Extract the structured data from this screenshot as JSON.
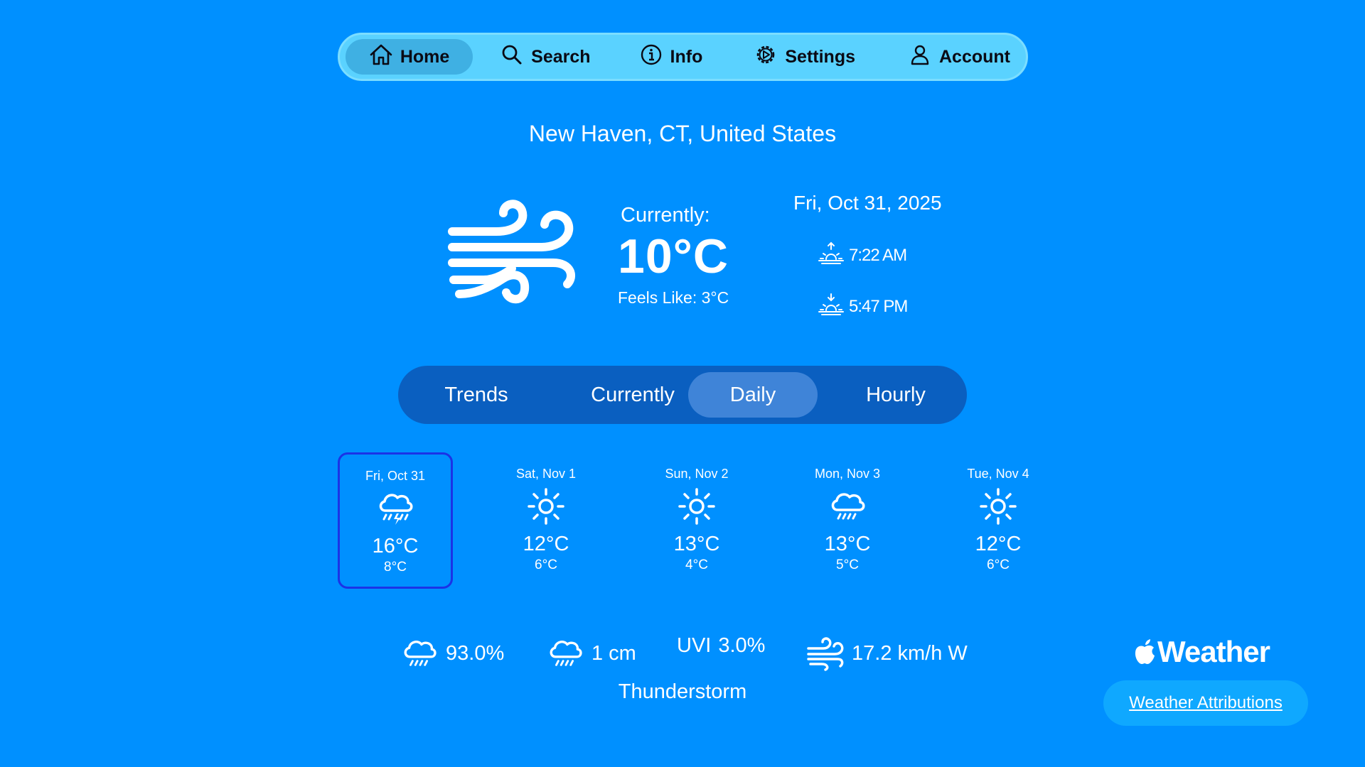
{
  "nav": {
    "home": "Home",
    "search": "Search",
    "info": "Info",
    "settings": "Settings",
    "account": "Account"
  },
  "location": "New Haven, CT, United States",
  "current": {
    "label": "Currently:",
    "temp": "10°C",
    "feels_like": "Feels Like: 3°C",
    "date": "Fri, Oct 31, 2025",
    "sunrise": "7:22 AM",
    "sunset": "5:47 PM",
    "icon": "wind-icon"
  },
  "tabs": {
    "trends": "Trends",
    "currently": "Currently",
    "daily": "Daily",
    "hourly": "Hourly",
    "active": "Daily"
  },
  "forecast": [
    {
      "day": "Fri, Oct 31",
      "icon": "thunderstorm-icon",
      "high": "16°C",
      "low": "8°C",
      "selected": true
    },
    {
      "day": "Sat, Nov 1",
      "icon": "sun-icon",
      "high": "12°C",
      "low": "6°C"
    },
    {
      "day": "Sun, Nov 2",
      "icon": "sun-icon",
      "high": "13°C",
      "low": "4°C"
    },
    {
      "day": "Mon, Nov 3",
      "icon": "rain-icon",
      "high": "13°C",
      "low": "5°C"
    },
    {
      "day": "Tue, Nov 4",
      "icon": "sun-icon",
      "high": "12°C",
      "low": "6°C"
    }
  ],
  "details": {
    "precip_chance": "93.0%",
    "precip_amount": "1 cm",
    "uvi_label": "UVI",
    "uvi_value": "3.0%",
    "wind": "17.2 km/h W",
    "summary": "Thunderstorm"
  },
  "brand": "Weather",
  "attribution": "Weather Attributions",
  "colors": {
    "background": "#0090FF",
    "nav_bar": "#5AD2FF",
    "nav_active": "#3FB0E3",
    "tab_bar": "#0A5FC0",
    "tab_active": "#3F84D8",
    "selected_border": "#1B33E6",
    "attribution_button": "#0FA8FF"
  }
}
